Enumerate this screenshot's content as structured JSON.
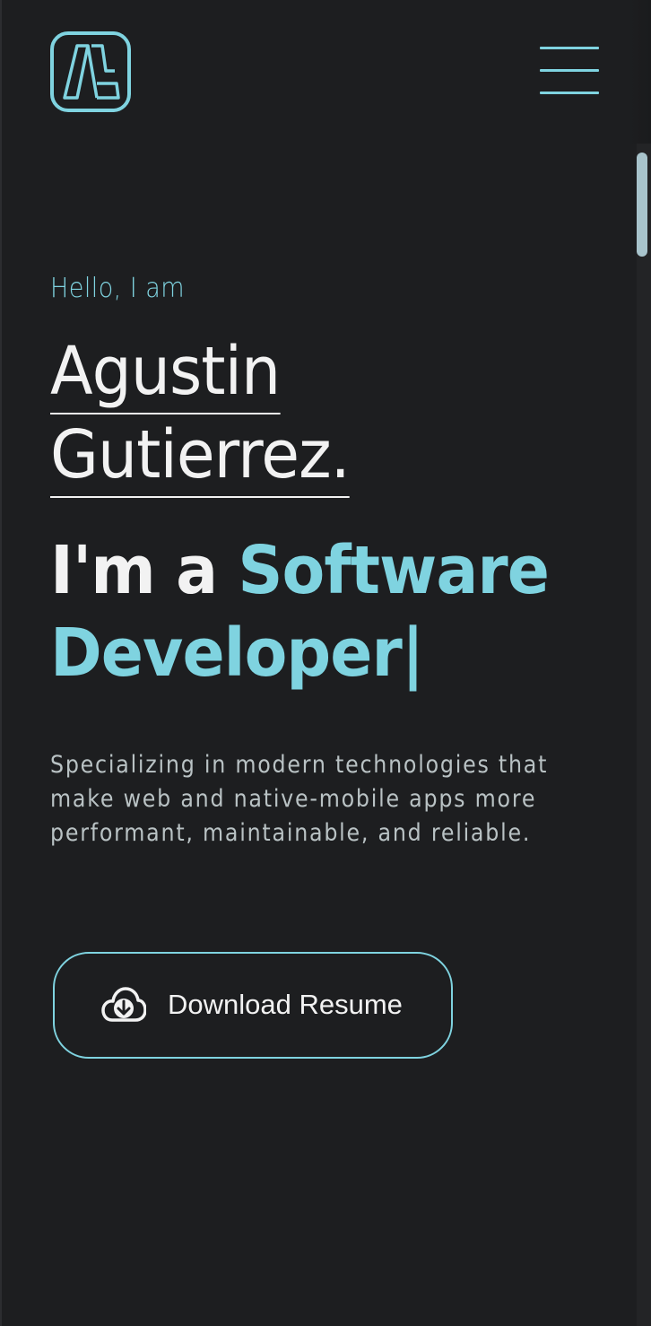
{
  "header": {
    "logo_icon": "monogram-logo-icon",
    "menu_icon": "hamburger-menu-icon"
  },
  "hero": {
    "greeting": "Hello, I am",
    "name_first": "Agustin",
    "name_last": "Gutierrez.",
    "role_prefix": "I'm a ",
    "role_word_1": "Software",
    "role_word_2": "Developer",
    "typing_cursor": "|",
    "description": "Specializing in modern technologies that make web and native-mobile apps more performant, maintainable, and reliable."
  },
  "cta": {
    "download_label": "Download Resume",
    "download_icon": "cloud-download-icon"
  },
  "colors": {
    "background": "#1d1e20",
    "accent": "#7fd3e0",
    "text": "#f2f2f2",
    "muted_text": "#b9c2c4"
  }
}
